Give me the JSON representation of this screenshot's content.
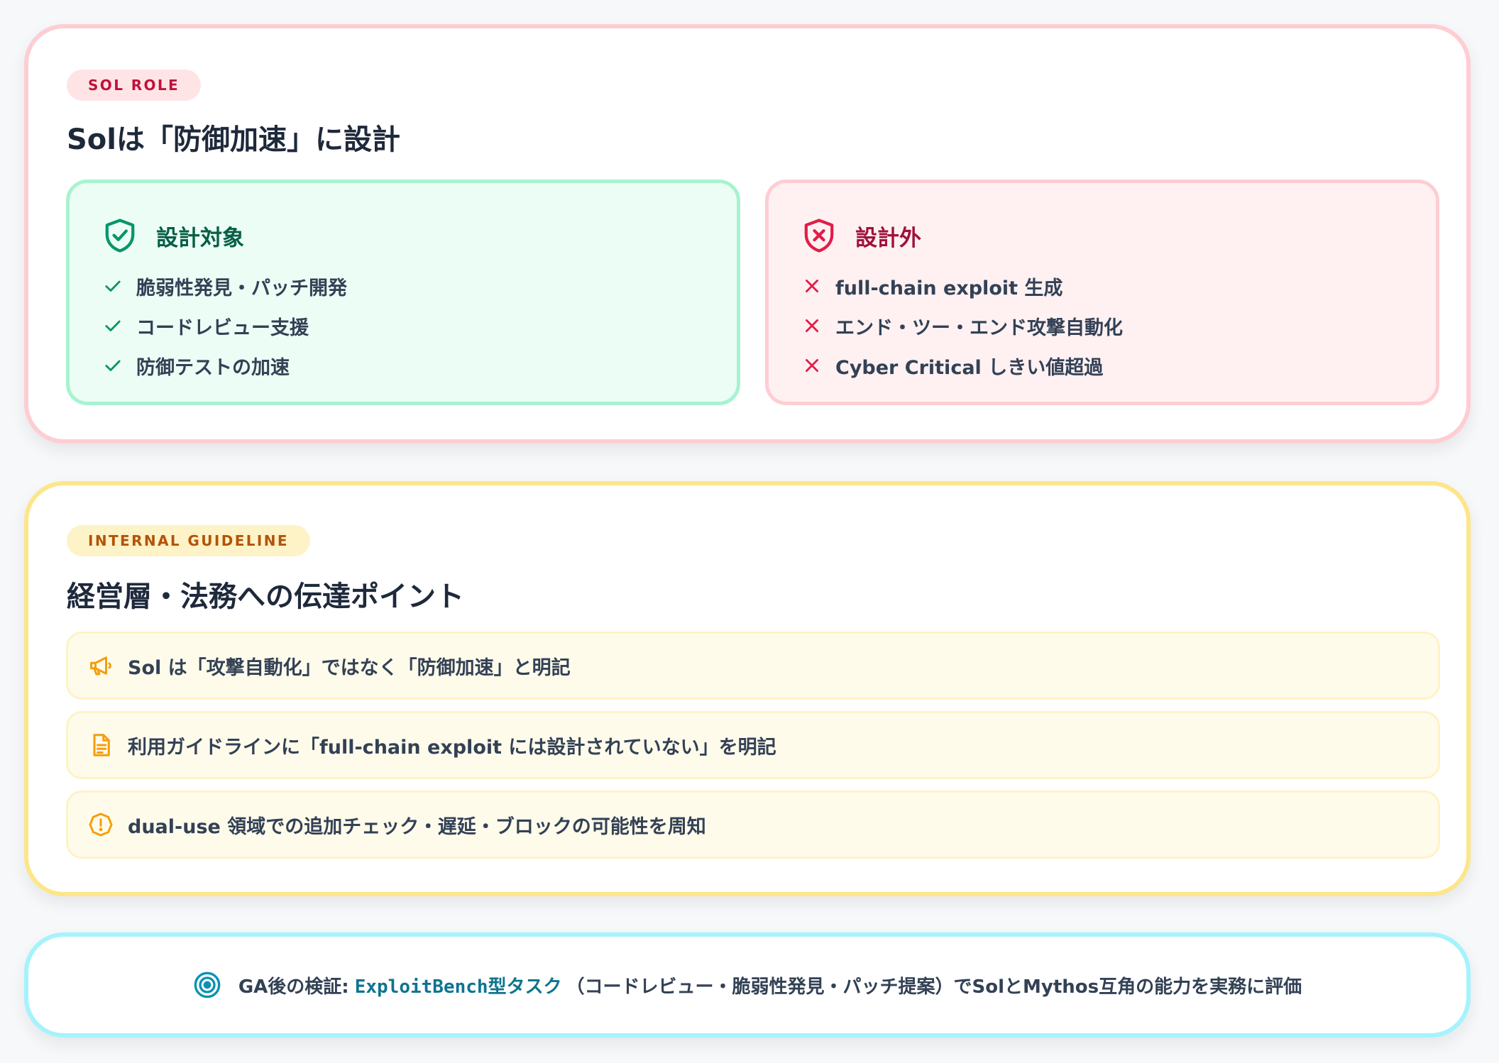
{
  "colors": {
    "page_background": "#f7f8fa",
    "role_border": "#fecdd3",
    "guide_border": "#fde68a",
    "ga_border": "#a5f3fc",
    "in_scope_green": "#059669",
    "out_scope_red": "#e11d48",
    "guide_amber": "#f59e0b",
    "ga_teal": "#0891b2"
  },
  "sol_role": {
    "badge": "SOL ROLE",
    "title": "Solは「防御加速」に設計",
    "in_scope": {
      "icon": "shield-check-icon",
      "title": "設計対象",
      "items": [
        "脆弱性発見・パッチ開発",
        "コードレビュー支援",
        "防御テストの加速"
      ]
    },
    "out_of_scope": {
      "icon": "shield-x-icon",
      "title": "設計外",
      "items": [
        "full-chain exploit 生成",
        "エンド・ツー・エンド攻撃自動化",
        "Cyber Critical しきい値超過"
      ]
    }
  },
  "internal_guideline": {
    "badge": "INTERNAL GUIDELINE",
    "title": "経営層・法務への伝達ポイント",
    "items": [
      {
        "icon": "megaphone-icon",
        "text": "Sol は「攻撃自動化」ではなく「防御加速」と明記"
      },
      {
        "icon": "document-icon",
        "text": "利用ガイドラインに「full-chain exploit には設計されていない」を明記"
      },
      {
        "icon": "warning-circle-icon",
        "text": "dual-use 領域での追加チェック・遅延・ブロックの可能性を周知"
      }
    ]
  },
  "ga_validation": {
    "icon": "target-icon",
    "label": "GA後の検証:",
    "accent": "ExploitBench型タスク",
    "rest": "（コードレビュー・脆弱性発見・パッチ提案）でSolとMythos互角の能力を実務に評価"
  }
}
